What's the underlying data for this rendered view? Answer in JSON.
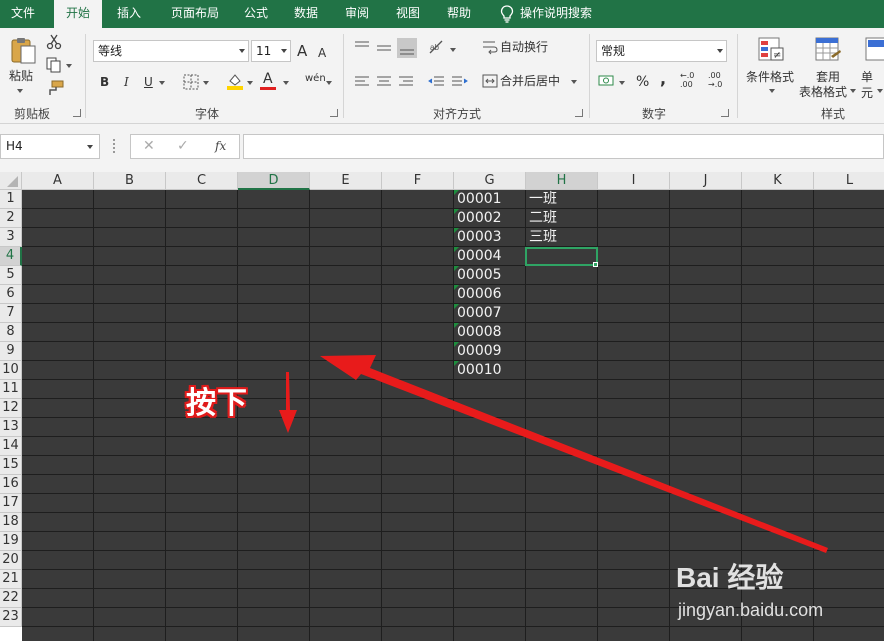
{
  "tabs": [
    {
      "label": "文件",
      "active": false
    },
    {
      "label": "开始",
      "active": true
    },
    {
      "label": "插入",
      "active": false
    },
    {
      "label": "页面布局",
      "active": false
    },
    {
      "label": "公式",
      "active": false
    },
    {
      "label": "数据",
      "active": false
    },
    {
      "label": "审阅",
      "active": false
    },
    {
      "label": "视图",
      "active": false
    },
    {
      "label": "帮助",
      "active": false
    }
  ],
  "tell_me": "操作说明搜索",
  "ribbon": {
    "clipboard": {
      "paste": "粘贴",
      "group": "剪贴板"
    },
    "font": {
      "name": "等线",
      "size": "11",
      "grow": "A",
      "shrink": "A",
      "bold": "B",
      "italic": "I",
      "underline": "U",
      "color_letter": "A",
      "phonetic": "wén",
      "group": "字体"
    },
    "alignment": {
      "wrap": "自动换行",
      "merge": "合并后居中",
      "group": "对齐方式"
    },
    "number": {
      "format": "常规",
      "percent": "%",
      "comma": ",",
      "inc_decimal": "←.0 .00",
      "dec_decimal": ".00 →.0",
      "group": "数字"
    },
    "styles": {
      "conditional": "条件格式",
      "table_format_1": "套用",
      "table_format_2": "表格格式",
      "cell_styles": "单元",
      "group": "样式"
    }
  },
  "formula_bar": {
    "name_box": "H4",
    "fx": "fx",
    "cancel": "✕",
    "enter": "✓",
    "content": ""
  },
  "columns": [
    "A",
    "B",
    "C",
    "D",
    "E",
    "F",
    "G",
    "H",
    "I",
    "J",
    "K",
    "L"
  ],
  "selected_column": "D",
  "active_column": "H",
  "rows": [
    "1",
    "2",
    "3",
    "4",
    "5",
    "6",
    "7",
    "8",
    "9",
    "10",
    "11",
    "12",
    "13",
    "14",
    "15",
    "16",
    "17",
    "18",
    "19",
    "20",
    "21",
    "22",
    "23"
  ],
  "active_row": "4",
  "column_g": [
    "00001",
    "00002",
    "00003",
    "00004",
    "00005",
    "00006",
    "00007",
    "00008",
    "00009",
    "00010"
  ],
  "column_h": [
    "一班",
    "二班",
    "三班"
  ],
  "annotation_text": "按下",
  "watermark": {
    "main": "Bai 经验",
    "sub": "jingyan.baidu.com"
  },
  "colors": {
    "excel_green": "#217346",
    "sheet_bg": "#3a3a3a",
    "arrow_red": "#e01b1b"
  }
}
